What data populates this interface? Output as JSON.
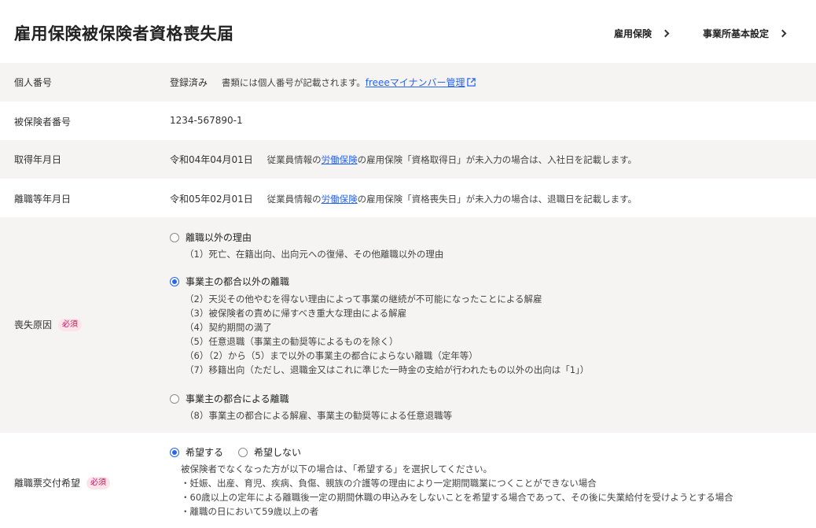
{
  "header": {
    "title": "雇用保険被保険者資格喪失届",
    "links": [
      "雇用保険",
      "事業所基本設定"
    ]
  },
  "rows": {
    "personal_number": {
      "label": "個人番号",
      "status": "登録済み",
      "note": "書類には個人番号が記載されます。",
      "link": "freeeマイナンバー管理"
    },
    "insured_number": {
      "label": "被保険者番号",
      "value": "1234-567890-1"
    },
    "acquired_date": {
      "label": "取得年月日",
      "value": "令和04年04月01日",
      "note_pre": "従業員情報の",
      "note_link": "労働保険",
      "note_post": "の雇用保険「資格取得日」が未入力の場合は、入社日を記載します。"
    },
    "leave_date": {
      "label": "離職等年月日",
      "value": "令和05年02月01日",
      "note_pre": "従業員情報の",
      "note_link": "労働保険",
      "note_post": "の雇用保険「資格喪失日」が未入力の場合は、退職日を記載します。"
    },
    "loss_reason": {
      "label": "喪失原因",
      "required": "必須",
      "options": [
        {
          "label": "離職以外の理由",
          "selected": false,
          "details": [
            "（1）死亡、在籍出向、出向元への復帰、その他離職以外の理由"
          ]
        },
        {
          "label": "事業主の都合以外の離職",
          "selected": true,
          "details": [
            "（2）天災その他やむを得ない理由によって事業の継続が不可能になったことによる解雇",
            "（3）被保険者の責めに帰すべき重大な理由による解雇",
            "（4）契約期間の満了",
            "（5）任意退職（事業主の勧奨等によるものを除く）",
            "（6）（2）から（5）まで以外の事業主の都合によらない離職（定年等）",
            "（7）移籍出向（ただし、退職金又はこれに準じた一時金の支給が行われたもの以外の出向は「1」）"
          ]
        },
        {
          "label": "事業主の都合による離職",
          "selected": false,
          "details": [
            "（8）事業主の都合による解雇、事業主の勧奨等による任意退職等"
          ]
        }
      ]
    },
    "separation_slip": {
      "label": "離職票交付希望",
      "required": "必須",
      "options": [
        {
          "label": "希望する",
          "selected": true
        },
        {
          "label": "希望しない",
          "selected": false
        }
      ],
      "details": [
        "被保険者でなくなった方が以下の場合は、「希望する」を選択してください。",
        "・妊娠、出産、育児、疾病、負傷、親族の介護等の理由により一定期間職業につくことができない場合",
        "・60歳以上の定年による離職後一定の期間休職の申込みをしないことを希望する場合であって、その後に失業給付を受けようとする場合",
        "・離職の日において59歳以上の者"
      ]
    }
  },
  "colors": {
    "accent": "#2864f0",
    "row_shade": "#f5f4f3",
    "required_text": "#c2185b",
    "required_bg": "#fce4ea"
  }
}
